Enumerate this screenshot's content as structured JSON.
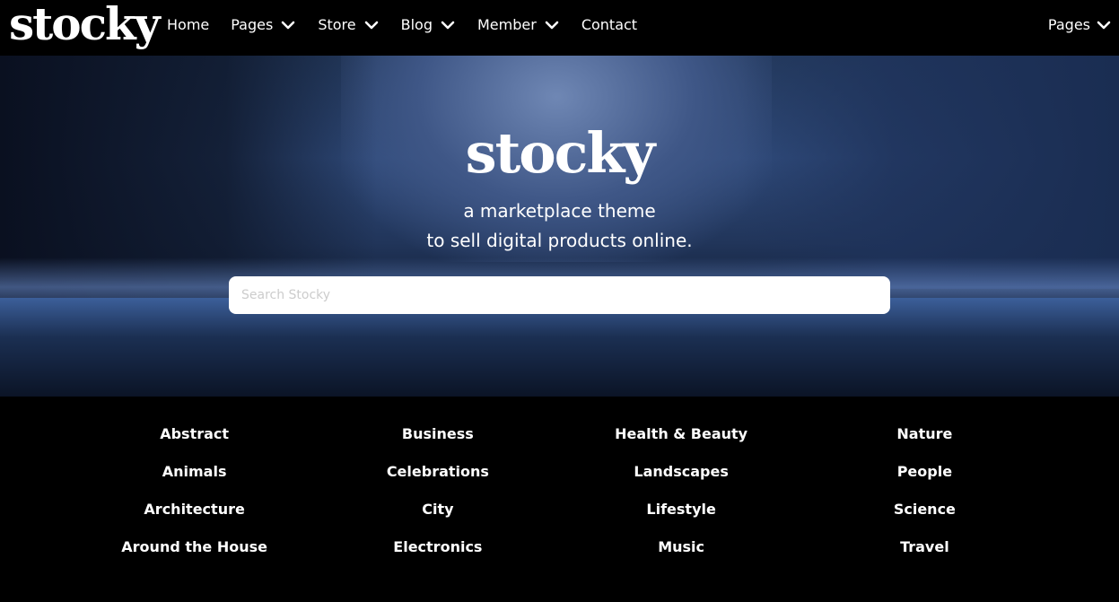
{
  "brand": {
    "logo": "stocky"
  },
  "nav": {
    "items": [
      {
        "label": "Home",
        "has_dropdown": false
      },
      {
        "label": "Pages",
        "has_dropdown": true
      },
      {
        "label": "Store",
        "has_dropdown": true
      },
      {
        "label": "Blog",
        "has_dropdown": true
      },
      {
        "label": "Member",
        "has_dropdown": true
      },
      {
        "label": "Contact",
        "has_dropdown": false
      }
    ],
    "right_item": {
      "label": "Pages",
      "has_dropdown": true
    }
  },
  "hero": {
    "title": "stocky",
    "subtitle_line1": "a marketplace theme",
    "subtitle_line2": "to sell digital products online.",
    "search_placeholder": "Search Stocky"
  },
  "categories": {
    "columns": [
      [
        "Abstract",
        "Animals",
        "Architecture",
        "Around the House"
      ],
      [
        "Business",
        "Celebrations",
        "City",
        "Electronics"
      ],
      [
        "Health & Beauty",
        "Landscapes",
        "Lifestyle",
        "Music"
      ],
      [
        "Nature",
        "People",
        "Science",
        "Travel"
      ]
    ]
  },
  "colors": {
    "background": "#000000",
    "text": "#ffffff",
    "hero_tone": "#2f4a7a"
  }
}
